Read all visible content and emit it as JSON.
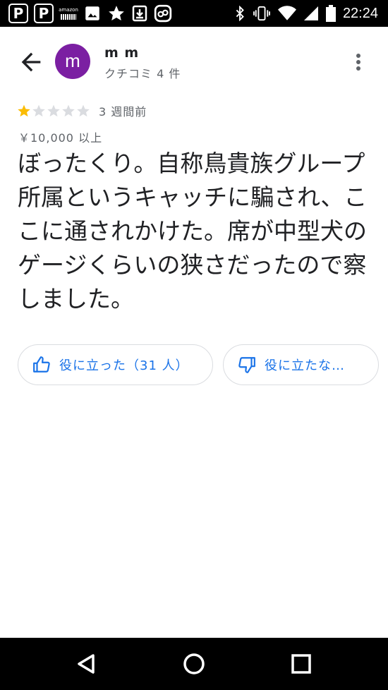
{
  "status_bar": {
    "icons": [
      "paypay-icon",
      "paypay-icon",
      "amazon-icon",
      "image-icon",
      "star-icon",
      "download-icon",
      "link-icon",
      "bluetooth-icon",
      "vibrate-icon",
      "wifi-icon",
      "signal-icon",
      "battery-icon"
    ],
    "amazon_label": "amazon",
    "time": "22:24"
  },
  "header": {
    "avatar_letter": "m",
    "user_name": "m m",
    "review_count": "クチコミ 4 件"
  },
  "review": {
    "rating": 1,
    "max_rating": 5,
    "time_ago": "3 週間前",
    "price": "￥10,000 以上",
    "text": "ぼったくり。自称鳥貴族グループ所属というキャッチに騙され、ここに通されかけた。席が中型犬のゲージくらいの狭さだったので察しました。"
  },
  "actions": {
    "helpful_label": "役に立った（31 人）",
    "not_helpful_label": "役に立たな…"
  },
  "colors": {
    "accent": "#1a73e8",
    "avatar": "#7b1fa2",
    "star_filled": "#fbbc04",
    "star_empty": "#dadce0"
  }
}
